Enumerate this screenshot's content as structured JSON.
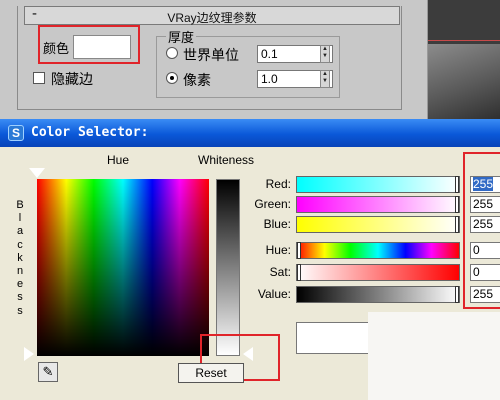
{
  "rollout": {
    "minus": "-",
    "title": "VRay边纹理参数",
    "color_label": "颜色",
    "hide_edges_label": "隐藏边",
    "thickness_title": "厚度",
    "world_units_label": "世界单位",
    "pixels_label": "像素",
    "world_units_value": "0.1",
    "pixels_value": "1.0",
    "selected_unit": "pixels"
  },
  "selector": {
    "title": "Color Selector:",
    "hue_label": "Hue",
    "whiteness_label": "Whiteness",
    "blackness_label": "Blackness",
    "reset_label": "Reset",
    "rows": [
      {
        "label": "Red:",
        "value": "255"
      },
      {
        "label": "Green:",
        "value": "255"
      },
      {
        "label": "Blue:",
        "value": "255"
      },
      {
        "label": "Hue:",
        "value": "0"
      },
      {
        "label": "Sat:",
        "value": "0"
      },
      {
        "label": "Value:",
        "value": "255"
      }
    ],
    "current_color": "#FFFFFF"
  },
  "colors": {
    "highlight": "#E0242A",
    "titlebar": "#0A58D8",
    "window_bg": "#ECE9D8"
  }
}
